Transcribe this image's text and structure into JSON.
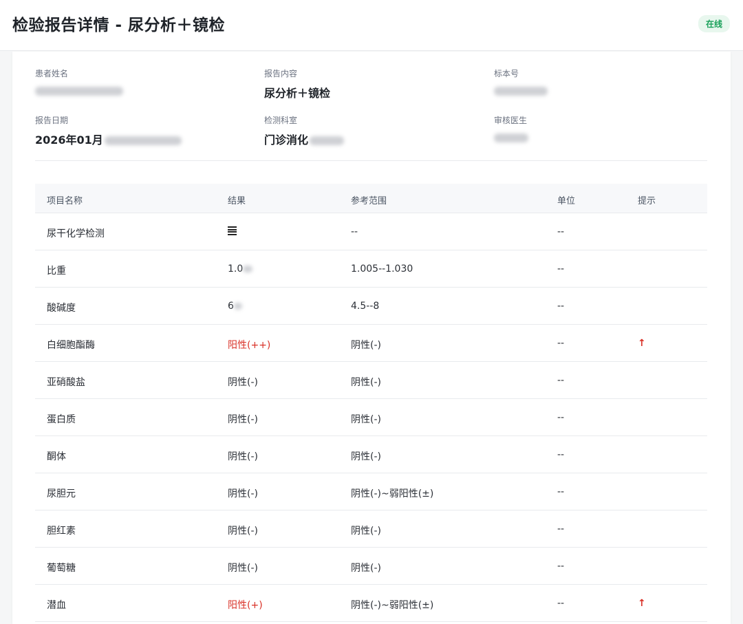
{
  "header": {
    "title": "检验报告详情 - 尿分析＋镜检",
    "status": "在线"
  },
  "info": {
    "patient_name_label": "患者姓名",
    "patient_name_value": "",
    "report_content_label": "报告内容",
    "report_content_value": "尿分析＋镜检",
    "specimen_no_label": "标本号",
    "specimen_no_value": "",
    "report_date_label": "报告日期",
    "report_date_value": "2026年01月",
    "department_label": "检测科室",
    "department_value": "门诊消化",
    "reviewer_label": "审核医生",
    "reviewer_value": ""
  },
  "table": {
    "headers": [
      "项目名称",
      "结果",
      "参考范围",
      "单位",
      "提示"
    ],
    "rows": [
      {
        "name": "尿干化学检测",
        "result": "",
        "reference": "--",
        "unit": "--",
        "hint": "",
        "abnormal": false
      },
      {
        "name": "比重",
        "result": "1.0",
        "reference": "1.005--1.030",
        "unit": "--",
        "hint": "",
        "abnormal": false
      },
      {
        "name": "酸碱度",
        "result": "6",
        "reference": "4.5--8",
        "unit": "--",
        "hint": "",
        "abnormal": false
      },
      {
        "name": "白细胞酯酶",
        "result": "阳性(++)",
        "reference": "阴性(-)",
        "unit": "--",
        "hint": "↑",
        "abnormal": true
      },
      {
        "name": "亚硝酸盐",
        "result": "阴性(-)",
        "reference": "阴性(-)",
        "unit": "--",
        "hint": "",
        "abnormal": false
      },
      {
        "name": "蛋白质",
        "result": "阴性(-)",
        "reference": "阴性(-)",
        "unit": "--",
        "hint": "",
        "abnormal": false
      },
      {
        "name": "酮体",
        "result": "阴性(-)",
        "reference": "阴性(-)",
        "unit": "--",
        "hint": "",
        "abnormal": false
      },
      {
        "name": "尿胆元",
        "result": "阴性(-)",
        "reference": "阴性(-)~弱阳性(±)",
        "unit": "--",
        "hint": "",
        "abnormal": false
      },
      {
        "name": "胆红素",
        "result": "阴性(-)",
        "reference": "阴性(-)",
        "unit": "--",
        "hint": "",
        "abnormal": false
      },
      {
        "name": "葡萄糖",
        "result": "阴性(-)",
        "reference": "阴性(-)",
        "unit": "--",
        "hint": "",
        "abnormal": false
      },
      {
        "name": "潜血",
        "result": "阳性(+)",
        "reference": "阴性(-)~弱阳性(±)",
        "unit": "--",
        "hint": "↑",
        "abnormal": true
      }
    ]
  },
  "colors": {
    "abnormal": "#d93026",
    "status_bg": "#e8f7ee",
    "status_text": "#1aa15a"
  },
  "icons": {
    "hint_arrow": "arrow-up-icon",
    "dry_chemistry_result": "list-lines-icon"
  }
}
